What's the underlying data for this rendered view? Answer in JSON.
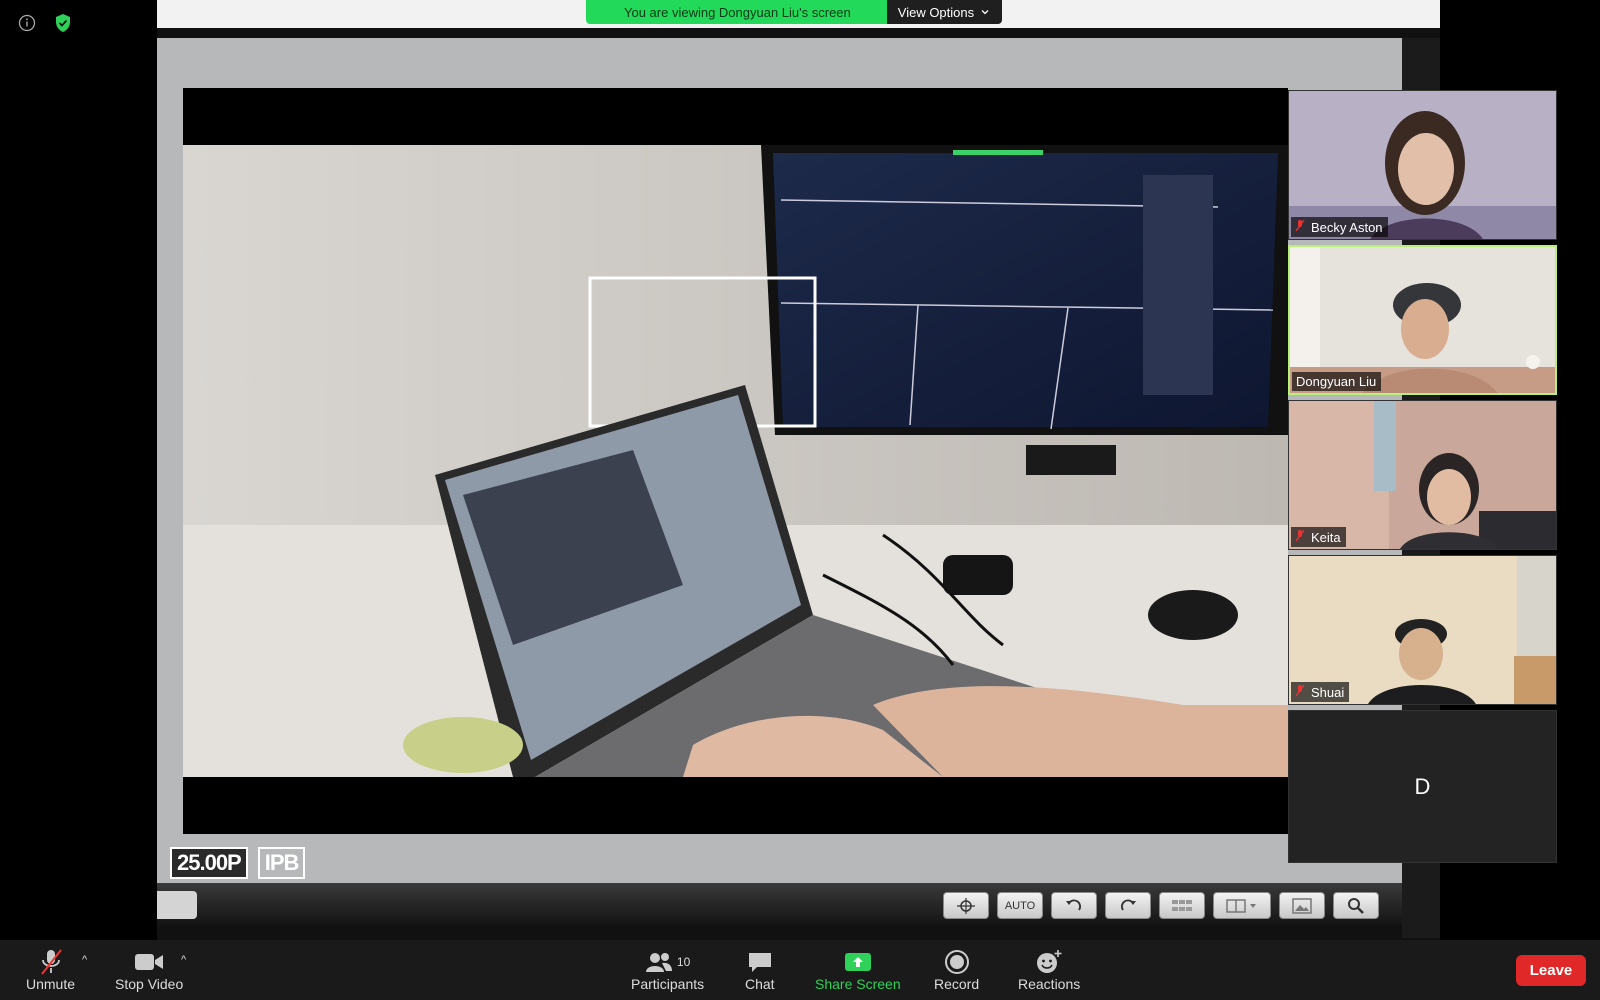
{
  "banner": {
    "text": "You are viewing Dongyuan Liu's screen",
    "options_label": "View Options"
  },
  "shared_screen": {
    "badges": [
      "25.00P",
      "IPB"
    ],
    "toolbar_icons": [
      "crosshair-icon",
      "auto-focus-icon",
      "rotate-left-icon",
      "rotate-right-icon",
      "grid-icon",
      "panel-layout-icon",
      "image-icon",
      "magnify-icon"
    ],
    "toolbar_auto_label": "AUTO"
  },
  "participants": [
    {
      "name": "Becky Aston",
      "muted": true,
      "active": false
    },
    {
      "name": "Dongyuan Liu",
      "muted": false,
      "active": true
    },
    {
      "name": "Keita",
      "muted": true,
      "active": false
    },
    {
      "name": "Shuai",
      "muted": true,
      "active": false
    }
  ],
  "blank_tile_initial": "D",
  "controls": {
    "unmute": "Unmute",
    "stop_video": "Stop Video",
    "participants": "Participants",
    "participants_count": "10",
    "chat": "Chat",
    "share_screen": "Share Screen",
    "record": "Record",
    "reactions": "Reactions",
    "leave": "Leave"
  },
  "colors": {
    "banner_green": "#23d959",
    "share_green": "#2fd15a",
    "leave_red": "#e02828",
    "active_border": "#b9f07a"
  }
}
